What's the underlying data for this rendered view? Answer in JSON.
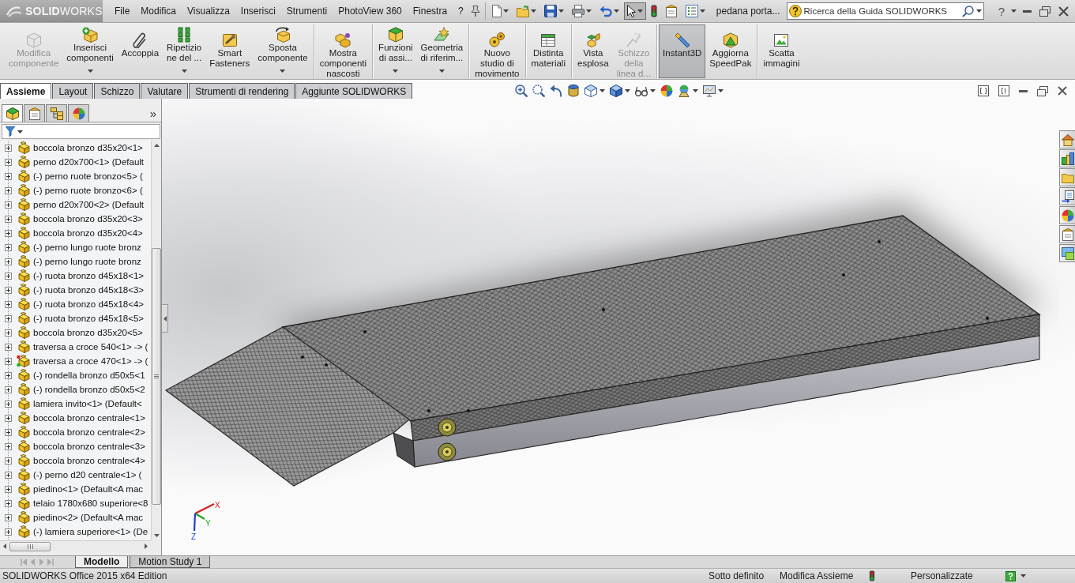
{
  "title_bar": {
    "logo": "**SOLID**WORKS",
    "menu": [
      "File",
      "Modifica",
      "Visualizza",
      "Inserisci",
      "Strumenti",
      "PhotoView 360",
      "Finestra",
      "?"
    ],
    "quick_access": [
      {
        "dropdown": true,
        "pressed": false
      },
      {
        "dropdown": true,
        "pressed": false
      },
      {
        "dropdown": true,
        "pressed": false
      },
      {
        "dropdown": true,
        "pressed": false
      },
      {
        "dropdown": true,
        "pressed": false
      },
      {
        "dropdown": true,
        "pressed": true
      },
      {
        "dropdown": false,
        "pressed": false
      },
      {
        "dropdown": false,
        "pressed": false
      },
      {
        "dropdown": true,
        "pressed": false
      }
    ],
    "document_title": "pedana porta...",
    "search": {
      "placeholder": "Ricerca della Guida SOLIDWORKS"
    },
    "help": "?"
  },
  "ribbon": {
    "groups": [
      {
        "buttons": [
          {
            "label_lines": [
              "Modifica",
              "componente"
            ],
            "disabled": true,
            "dropdown": false,
            "on": false
          },
          {
            "label_lines": [
              "Inserisci",
              "componenti"
            ],
            "disabled": false,
            "dropdown": true,
            "on": false
          },
          {
            "label_lines": [
              "Accoppia"
            ],
            "disabled": false,
            "dropdown": false,
            "on": false
          },
          {
            "label_lines": [
              "Ripetizio",
              "ne del ..."
            ],
            "disabled": false,
            "dropdown": true,
            "on": false
          },
          {
            "label_lines": [
              "Smart",
              "Fasteners"
            ],
            "disabled": false,
            "dropdown": false,
            "on": false
          },
          {
            "label_lines": [
              "Sposta",
              "componente"
            ],
            "disabled": false,
            "dropdown": true,
            "on": false
          }
        ]
      },
      {
        "buttons": [
          {
            "label_lines": [
              "Mostra",
              "componenti",
              "nascosti"
            ],
            "disabled": false,
            "dropdown": false,
            "on": false
          }
        ]
      },
      {
        "buttons": [
          {
            "label_lines": [
              "Funzioni",
              "di assi..."
            ],
            "disabled": false,
            "dropdown": true,
            "on": false
          },
          {
            "label_lines": [
              "Geometria",
              "di riferim..."
            ],
            "disabled": false,
            "dropdown": true,
            "on": false
          }
        ]
      },
      {
        "buttons": [
          {
            "label_lines": [
              "Nuovo",
              "studio di",
              "movimento"
            ],
            "disabled": false,
            "dropdown": false,
            "on": false
          }
        ]
      },
      {
        "buttons": [
          {
            "label_lines": [
              "Distinta",
              "materiali"
            ],
            "disabled": false,
            "dropdown": false,
            "on": false
          }
        ]
      },
      {
        "buttons": [
          {
            "label_lines": [
              "Vista",
              "esplosa"
            ],
            "disabled": false,
            "dropdown": false,
            "on": false
          },
          {
            "label_lines": [
              "Schizzo",
              "della",
              "linea d..."
            ],
            "disabled": true,
            "dropdown": false,
            "on": false
          }
        ]
      },
      {
        "buttons": [
          {
            "label_lines": [
              "Instant3D"
            ],
            "disabled": false,
            "dropdown": false,
            "on": true
          },
          {
            "label_lines": [
              "Aggiorna",
              "SpeedPak"
            ],
            "disabled": false,
            "dropdown": false,
            "on": false
          }
        ]
      },
      {
        "buttons": [
          {
            "label_lines": [
              "Scatta",
              "immagini"
            ],
            "disabled": false,
            "dropdown": false,
            "on": false
          }
        ]
      }
    ]
  },
  "command_tabs": [
    {
      "label": "Assieme",
      "selected": true
    },
    {
      "label": "Layout",
      "selected": false
    },
    {
      "label": "Schizzo",
      "selected": false
    },
    {
      "label": "Valutare",
      "selected": false
    },
    {
      "label": "Strumenti di rendering",
      "selected": false
    },
    {
      "label": "Aggiunte SOLIDWORKS",
      "selected": false
    }
  ],
  "view_toolbar": [
    {
      "dropdown": false
    },
    {
      "dropdown": false
    },
    {
      "dropdown": false
    },
    {
      "dropdown": false
    },
    {
      "dropdown": true
    },
    {
      "dropdown": true
    },
    {
      "dropdown": true
    },
    {
      "dropdown": false
    },
    {
      "dropdown": true
    },
    {
      "dropdown": true
    }
  ],
  "feature_manager": {
    "tabs": [
      {
        "selected": true
      },
      {
        "selected": false
      },
      {
        "selected": false
      },
      {
        "selected": false
      }
    ],
    "more": "»",
    "tree": [
      {
        "label": "boccola bronzo d35x20<1>",
        "expanded": false,
        "flag": false
      },
      {
        "label": "perno d20x700<1> (Default",
        "expanded": false,
        "flag": false
      },
      {
        "label": "(-) perno ruote bronzo<5> (",
        "expanded": false,
        "flag": false
      },
      {
        "label": "(-) perno ruote bronzo<6> (",
        "expanded": false,
        "flag": false
      },
      {
        "label": "perno d20x700<2> (Default",
        "expanded": false,
        "flag": false
      },
      {
        "label": "boccola bronzo d35x20<3>",
        "expanded": false,
        "flag": false
      },
      {
        "label": "boccola bronzo d35x20<4>",
        "expanded": false,
        "flag": false
      },
      {
        "label": "(-) perno lungo ruote bronz",
        "expanded": false,
        "flag": false
      },
      {
        "label": "(-) perno lungo ruote bronz",
        "expanded": false,
        "flag": false
      },
      {
        "label": "(-) ruota bronzo d45x18<1>",
        "expanded": false,
        "flag": false
      },
      {
        "label": "(-) ruota bronzo d45x18<3>",
        "expanded": false,
        "flag": false
      },
      {
        "label": "(-) ruota bronzo d45x18<4>",
        "expanded": false,
        "flag": false
      },
      {
        "label": "(-) ruota bronzo d45x18<5>",
        "expanded": false,
        "flag": false
      },
      {
        "label": "boccola bronzo d35x20<5>",
        "expanded": false,
        "flag": false
      },
      {
        "label": "traversa a croce 540<1> -> (",
        "expanded": false,
        "flag": false
      },
      {
        "label": "traversa a croce 470<1> -> (",
        "expanded": false,
        "flag": true
      },
      {
        "label": "(-) rondella bronzo d50x5<1",
        "expanded": false,
        "flag": false
      },
      {
        "label": "(-) rondella bronzo d50x5<2",
        "expanded": false,
        "flag": false
      },
      {
        "label": "lamiera invito<1> (Default<",
        "expanded": false,
        "flag": false
      },
      {
        "label": "boccola bronzo centrale<1>",
        "expanded": false,
        "flag": false
      },
      {
        "label": "boccola bronzo centrale<2>",
        "expanded": false,
        "flag": false
      },
      {
        "label": "boccola bronzo centrale<3>",
        "expanded": false,
        "flag": false
      },
      {
        "label": "boccola bronzo centrale<4>",
        "expanded": false,
        "flag": false
      },
      {
        "label": "(-) perno d20 centrale<1> (",
        "expanded": false,
        "flag": false
      },
      {
        "label": "piedino<1> (Default<A mac",
        "expanded": false,
        "flag": false
      },
      {
        "label": "telaio 1780x680 superiore<8",
        "expanded": false,
        "flag": false
      },
      {
        "label": "piedino<2> (Default<A mac",
        "expanded": false,
        "flag": false
      },
      {
        "label": "(-) lamiera superiore<1> (De",
        "expanded": false,
        "flag": false
      }
    ]
  },
  "graphics": {
    "triad_labels": [
      "X",
      "Y",
      "Z"
    ]
  },
  "bottom_tabs": [
    {
      "label": "Modello",
      "selected": true
    },
    {
      "label": "Motion Study 1",
      "selected": false
    }
  ],
  "status_bar": {
    "edition": "SOLIDWORKS Office 2015 x64 Edition",
    "items": [
      "Sotto definito",
      "Modifica Assieme"
    ],
    "units": "Personalizzate"
  }
}
